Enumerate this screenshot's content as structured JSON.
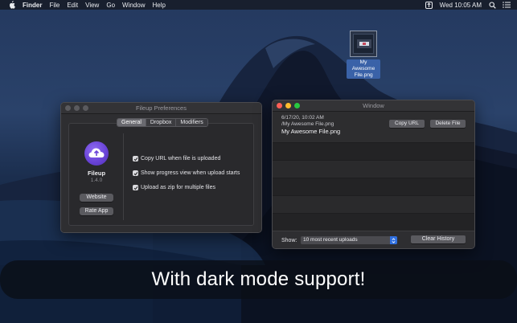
{
  "menubar": {
    "app_name": "Finder",
    "menus": [
      "File",
      "Edit",
      "View",
      "Go",
      "Window",
      "Help"
    ],
    "clock": "Wed 10:05 AM",
    "status_icons": [
      "fileup-status-icon",
      "search-icon",
      "list-icon"
    ]
  },
  "desktop": {
    "file_label": "My Awesome File.png"
  },
  "prefs_window": {
    "title": "Fileup Preferences",
    "tabs": [
      {
        "label": "General",
        "active": true
      },
      {
        "label": "Dropbox",
        "active": false
      },
      {
        "label": "Modifiers",
        "active": false
      }
    ],
    "app_name": "Fileup",
    "version": "1.4.0",
    "website_button": "Website",
    "rate_button": "Rate App",
    "options": [
      {
        "label": "Copy URL when file is uploaded",
        "checked": true
      },
      {
        "label": "Show progress view when upload starts",
        "checked": true
      },
      {
        "label": "Upload as zip for multiple files",
        "checked": true
      }
    ]
  },
  "uploads_window": {
    "title": "Window",
    "upload": {
      "date": "6/17/20, 10:02 AM",
      "path": "/My Awesome File.png",
      "name": "My Awesome File.png",
      "copy_button": "Copy URL",
      "delete_button": "Delete File"
    },
    "footer": {
      "show_label": "Show:",
      "selected_option": "10 most recent uploads",
      "clear_button": "Clear History"
    }
  },
  "banner": {
    "text": "With dark mode support!"
  },
  "colors": {
    "close": "#ff5f57",
    "minimize": "#febc2e",
    "zoom": "#28c840",
    "accent": "#2f6fe0",
    "logo": "#6a44d8"
  }
}
